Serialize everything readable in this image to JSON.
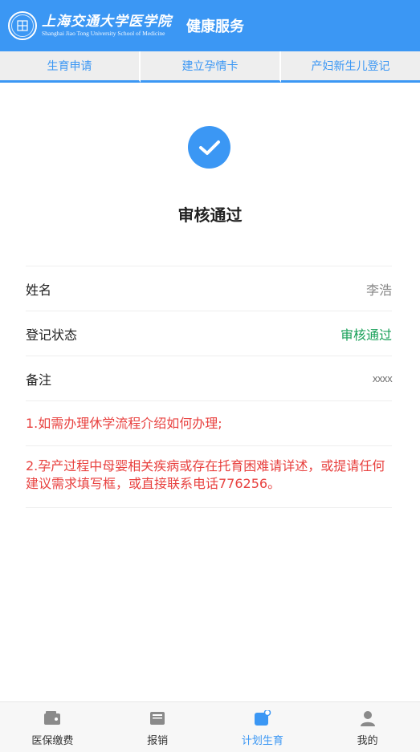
{
  "header": {
    "logo_cn": "上海交通大学医学院",
    "logo_en": "Shanghai Jiao Tong University School of Medicine",
    "title": "健康服务"
  },
  "tabs": [
    {
      "label": "生育申请"
    },
    {
      "label": "建立孕情卡"
    },
    {
      "label": "产妇新生儿登记"
    }
  ],
  "status": {
    "icon": "check-circle-icon",
    "title": "审核通过"
  },
  "info": {
    "rows": [
      {
        "label": "姓名",
        "value": "李浩"
      },
      {
        "label": "登记状态",
        "value": "审核通过"
      },
      {
        "label": "备注",
        "value": "xxxx"
      }
    ],
    "notes": [
      "1.如需办理休学流程介绍如何办理;",
      "2.孕产过程中母婴相关疾病或存在托育困难请详述，或提请任何建议需求填写框，或直接联系电话776256。"
    ]
  },
  "bottom_nav": [
    {
      "label": "医保缴费",
      "icon": "wallet-icon",
      "active": false
    },
    {
      "label": "报销",
      "icon": "inbox-icon",
      "active": false
    },
    {
      "label": "计划生育",
      "icon": "plan-icon",
      "active": true
    },
    {
      "label": "我的",
      "icon": "user-icon",
      "active": false
    }
  ],
  "colors": {
    "primary": "#3b97f4",
    "success": "#18a058",
    "note": "#e8413f"
  }
}
